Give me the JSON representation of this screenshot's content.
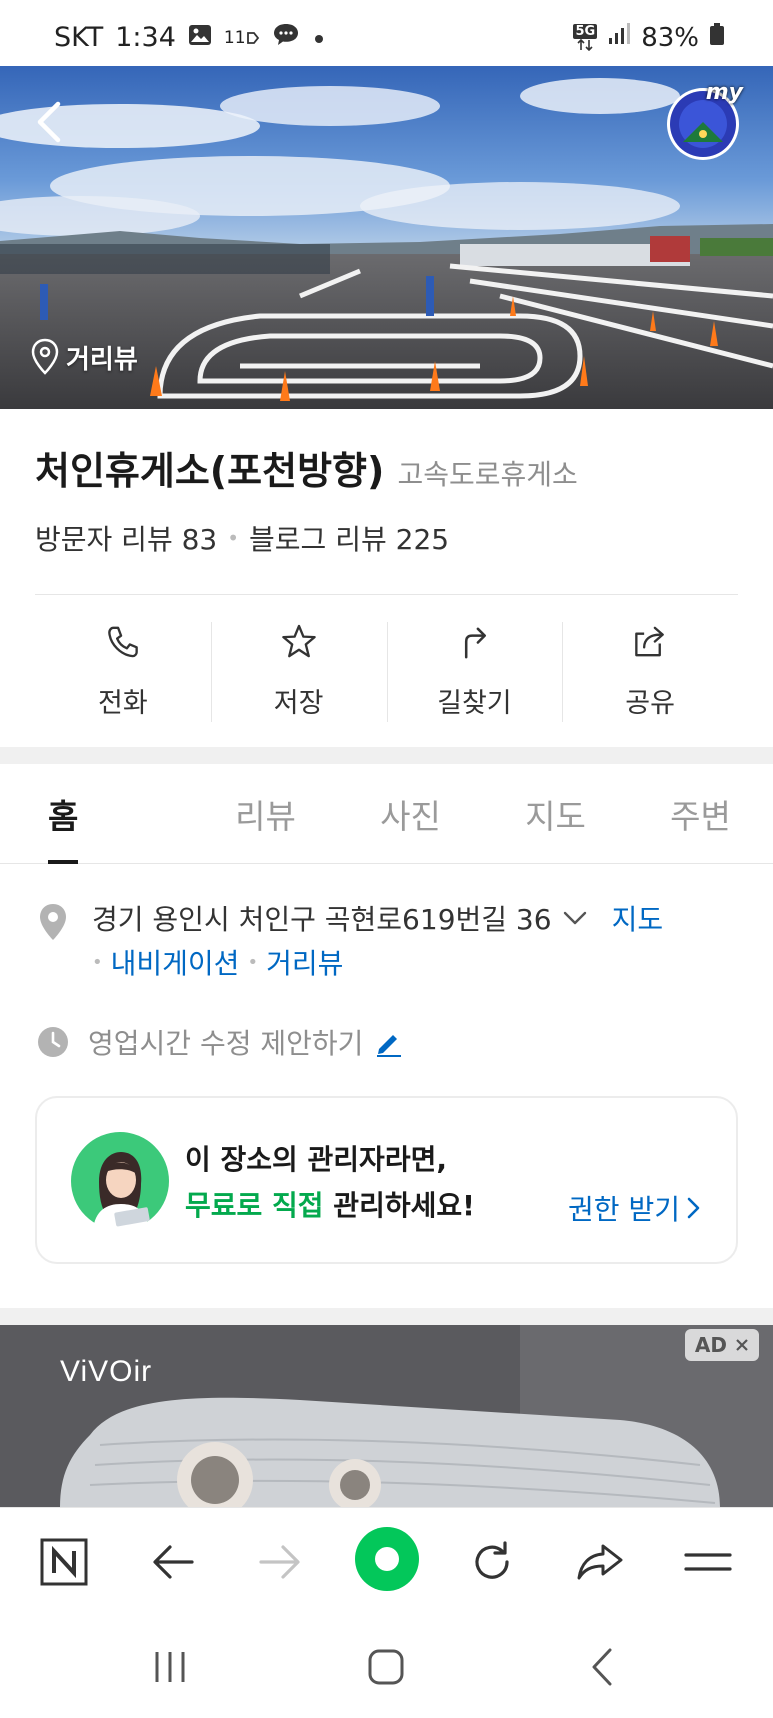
{
  "status_bar": {
    "carrier": "SKT",
    "time": "1:34",
    "notif_11": "11",
    "network": "5G",
    "battery": "83%"
  },
  "hero": {
    "streetview_label": "거리뷰",
    "my_label": "my"
  },
  "place": {
    "name": "처인휴게소(포천방향)",
    "category": "고속도로휴게소",
    "visitor_review_label": "방문자 리뷰 83",
    "blog_review_label": "블로그 리뷰 225"
  },
  "actions": [
    {
      "label": "전화",
      "icon": "phone-icon"
    },
    {
      "label": "저장",
      "icon": "star-icon"
    },
    {
      "label": "길찾기",
      "icon": "directions-icon"
    },
    {
      "label": "공유",
      "icon": "share-icon"
    }
  ],
  "tabs": [
    {
      "label": "홈",
      "active": true
    },
    {
      "label": "리뷰"
    },
    {
      "label": "사진"
    },
    {
      "label": "지도"
    },
    {
      "label": "주변"
    }
  ],
  "address": {
    "text": "경기 용인시 처인구 곡현로619번길 36",
    "map_link": "지도",
    "navigation_link": "내비게이션",
    "streetview_link": "거리뷰"
  },
  "hours": {
    "text": "영업시간 수정 제안하기"
  },
  "owner_card": {
    "line1": "이 장소의 관리자라면,",
    "line2_highlight": "무료로 직접",
    "line2_rest": " 관리하세요!",
    "cta": "권한 받기"
  },
  "ad": {
    "brand": "ViVOir",
    "badge": "AD"
  },
  "colors": {
    "link_blue": "#0068c3",
    "naver_green": "#03c75a",
    "owner_green": "#03a94d"
  }
}
